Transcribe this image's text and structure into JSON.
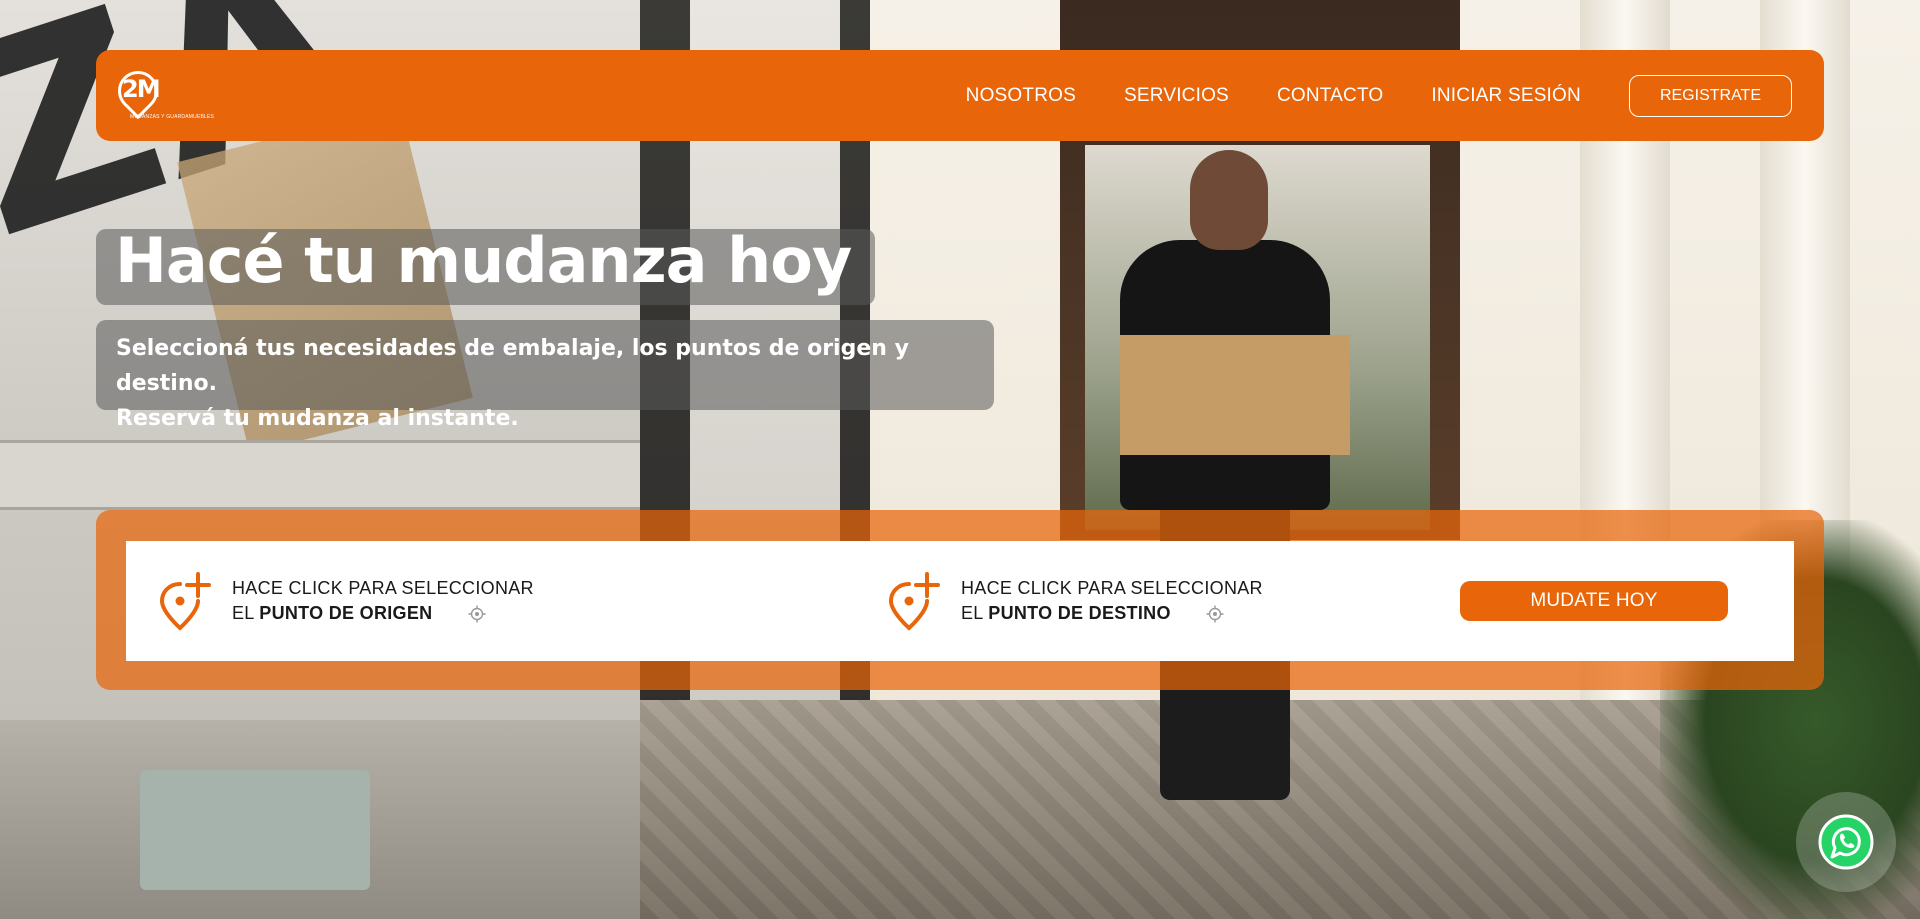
{
  "header": {
    "logo": {
      "mark_text": "2M",
      "subtitle": "MUDANZAS Y GUARDAMUEBLES"
    },
    "nav": [
      {
        "label": "NOSOTROS"
      },
      {
        "label": "SERVICIOS"
      },
      {
        "label": "CONTACTO"
      },
      {
        "label": "INICIAR SESIÓN"
      }
    ],
    "register_label": "REGISTRATE"
  },
  "hero": {
    "title": "Hacé tu mudanza hoy",
    "subtitle_line1": "Seleccioná tus necesidades de embalaje, los puntos de origen y destino.",
    "subtitle_line2": "Reservá tu mudanza al instante."
  },
  "booking": {
    "origin": {
      "line1": "HACE CLICK PARA SELECCIONAR",
      "prefix": "EL",
      "strong": "PUNTO DE ORIGEN",
      "icon": "map-pin-plus-icon"
    },
    "destination": {
      "line1": "HACE CLICK PARA SELECCIONAR",
      "prefix": "EL",
      "strong": "PUNTO DE DESTINO",
      "icon": "map-pin-plus-icon"
    },
    "cta_label": "MUDATE HOY"
  },
  "whatsapp": {
    "icon": "whatsapp-icon"
  },
  "colors": {
    "brand_orange": "#e8650a",
    "white": "#ffffff",
    "text_dark": "#1a1a1a"
  }
}
